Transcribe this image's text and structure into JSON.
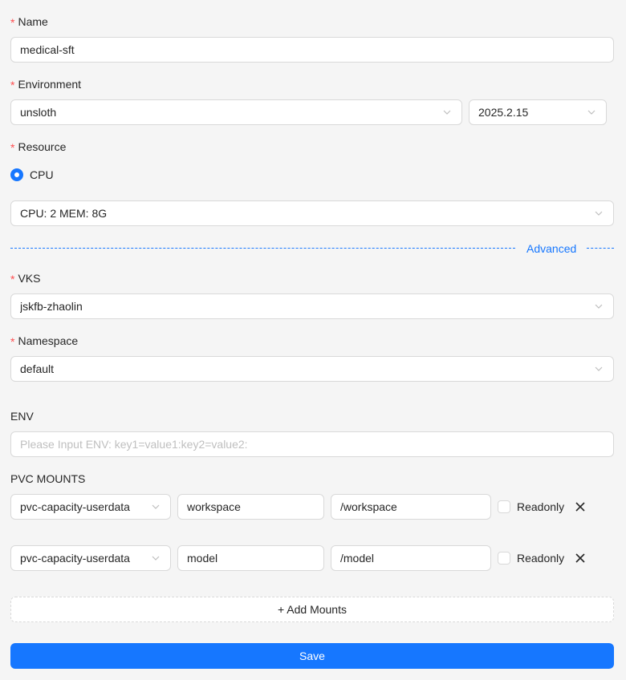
{
  "name": {
    "label": "Name",
    "required_mark": "*",
    "value": "medical-sft"
  },
  "environment": {
    "label": "Environment",
    "required_mark": "*",
    "image_value": "unsloth",
    "version_value": "2025.2.15"
  },
  "resource": {
    "label": "Resource",
    "required_mark": "*",
    "radio_option": "CPU",
    "spec_value": "CPU: 2 MEM: 8G"
  },
  "advanced": {
    "label": "Advanced"
  },
  "vks": {
    "label": "VKS",
    "required_mark": "*",
    "value": "jskfb-zhaolin"
  },
  "namespace": {
    "label": "Namespace",
    "required_mark": "*",
    "value": "default"
  },
  "env": {
    "label": "ENV",
    "value": "",
    "placeholder": "Please Input ENV: key1=value1:key2=value2:"
  },
  "pvc_mounts": {
    "label": "PVC MOUNTS",
    "readonly_label": "Readonly",
    "rows": [
      {
        "pvc": "pvc-capacity-userdata",
        "subpath": "workspace",
        "mount_path": "/workspace",
        "readonly": false
      },
      {
        "pvc": "pvc-capacity-userdata",
        "subpath": "model",
        "mount_path": "/model",
        "readonly": false
      }
    ]
  },
  "add_mounts_label": "+ Add Mounts",
  "save_label": "Save",
  "colors": {
    "primary": "#1677ff",
    "required": "#ff4d4f",
    "border": "#d9d9d9",
    "background": "#f5f5f5"
  },
  "icons": {
    "select": "chevron-down-icon",
    "remove": "close-icon"
  }
}
